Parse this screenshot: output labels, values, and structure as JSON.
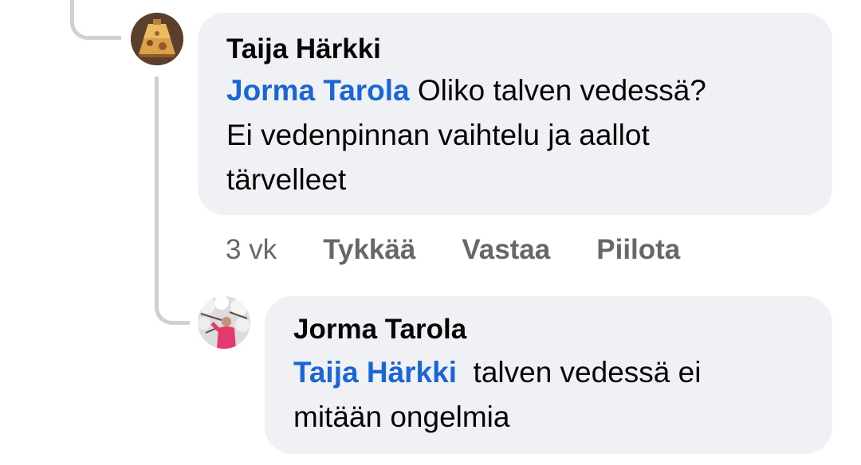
{
  "comments": [
    {
      "author": "Taija Härkki",
      "mention": "Jorma Tarola",
      "text_line1": " Oliko talven vedessä?",
      "text_line2": "Ei vedenpinnan vaihtelu ja aallot",
      "text_line3": "tärvelleet",
      "avatar_icon": "lamp-shade-avatar-icon",
      "actions": {
        "time": "3 vk",
        "like": "Tykkää",
        "reply": "Vastaa",
        "hide": "Piilota"
      }
    },
    {
      "author": "Jorma Tarola",
      "mention": "Taija Härkki",
      "text_line1": "  talven vedessä ei",
      "text_line2": "mitään ongelmia",
      "avatar_icon": "person-blossom-avatar-icon"
    }
  ],
  "colors": {
    "bubble": "#eff1f5",
    "mention": "#1a66d2",
    "muted": "#65676b",
    "thread_line": "#ced0d4"
  }
}
